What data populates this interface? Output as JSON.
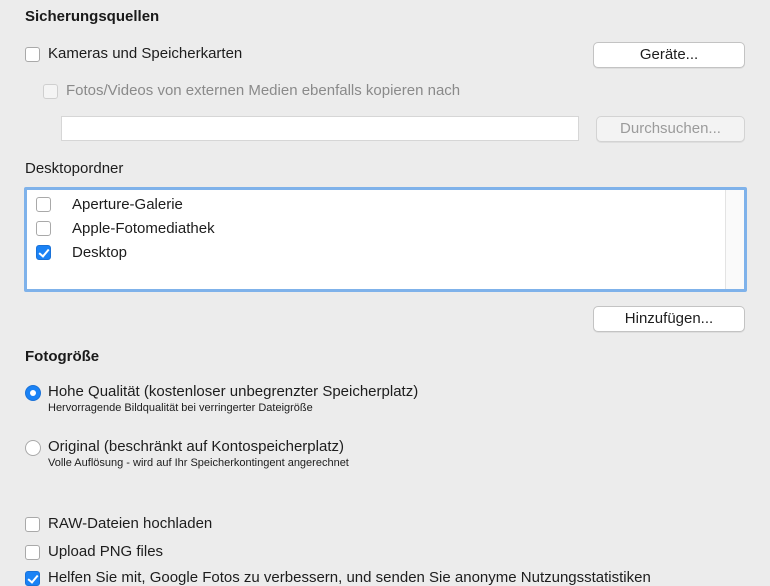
{
  "sources": {
    "heading": "Sicherungsquellen",
    "cameras_label": "Kameras und Speicherkarten",
    "devices_button": "Geräte...",
    "copy_external_label": "Fotos/Videos von externen Medien ebenfalls kopieren nach",
    "path_value": "",
    "browse_button": "Durchsuchen..."
  },
  "desktop_folders": {
    "label": "Desktopordner",
    "items": [
      {
        "label": "Aperture-Galerie",
        "checked": false
      },
      {
        "label": "Apple-Fotomediathek",
        "checked": false
      },
      {
        "label": "Desktop",
        "checked": true
      }
    ],
    "add_button": "Hinzufügen..."
  },
  "photo_size": {
    "heading": "Fotogröße",
    "high_quality_label": "Hohe Qualität (kostenloser unbegrenzter Speicherplatz)",
    "high_quality_desc": "Hervorragende Bildqualität bei verringerter Dateigröße",
    "original_label": "Original (beschränkt auf Kontospeicherplatz)",
    "original_desc": "Volle Auflösung - wird auf Ihr Speicherkontingent angerechnet",
    "selected": "high_quality"
  },
  "options": {
    "raw_label": "RAW-Dateien hochladen",
    "png_label": "Upload PNG files",
    "stats_label": "Helfen Sie mit, Google Fotos zu verbessern, und senden Sie anonyme Nutzungsstatistiken"
  },
  "colors": {
    "accent": "#1a82f5",
    "focus_ring": "#7fb2ea",
    "background": "#ececec"
  }
}
